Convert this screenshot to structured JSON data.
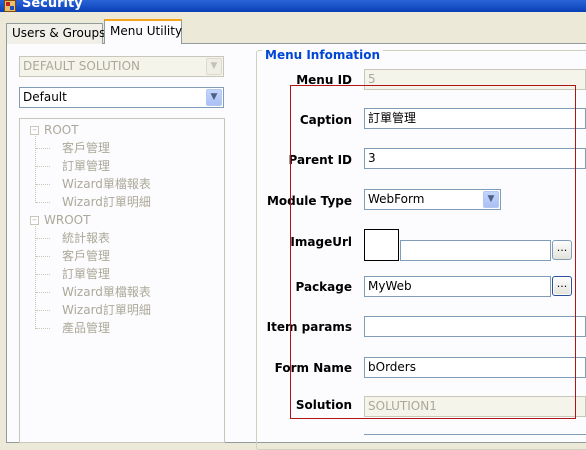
{
  "window": {
    "title": "Security"
  },
  "tabs": [
    {
      "label": "Users & Groups"
    },
    {
      "label": "Menu Utility"
    }
  ],
  "left": {
    "solution_combo": {
      "value": "DEFAULT SOLUTION",
      "enabled": false
    },
    "mode_combo": {
      "value": "Default"
    },
    "tree": {
      "roots": [
        {
          "label": "ROOT",
          "expanded": true,
          "children": [
            "客戶管理",
            "訂單管理",
            "Wizard單檔報表",
            "Wizard訂單明細"
          ]
        },
        {
          "label": "WROOT",
          "expanded": true,
          "children": [
            "統計報表",
            "客戶管理",
            "訂單管理",
            "Wizard單檔報表",
            "Wizard訂單明細",
            "產品管理"
          ]
        }
      ]
    }
  },
  "menu_info": {
    "group_title": "Menu Infomation",
    "fields": {
      "menu_id": {
        "label": "Menu ID",
        "value": "5"
      },
      "caption": {
        "label": "Caption",
        "value": "訂單管理"
      },
      "parent_id": {
        "label": "Parent ID",
        "value": "3"
      },
      "module_type": {
        "label": "Module Type",
        "value": "WebForm"
      },
      "image_url": {
        "label": "ImageUrl",
        "value": "",
        "browse_label": "..."
      },
      "package": {
        "label": "Package",
        "value": "MyWeb",
        "browse_label": "..."
      },
      "item_params": {
        "label": "Item params",
        "value": ""
      },
      "form_name": {
        "label": "Form Name",
        "value": "bOrders"
      },
      "solution": {
        "label": "Solution",
        "value": "SOLUTION1"
      }
    }
  },
  "colors": {
    "titlebar": "#0a3fb4",
    "group_title": "#0046d5",
    "highlight_box": "#b01515",
    "tab_accent": "#f6a51e"
  }
}
